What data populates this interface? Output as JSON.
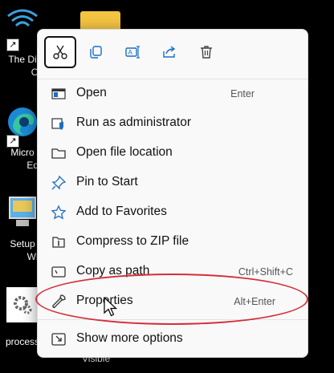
{
  "desktop": {
    "icons": [
      {
        "label_line1": "The Di",
        "label_line2": "Offi"
      },
      {
        "label_line1": "Micro",
        "label_line2": "Edg"
      },
      {
        "label_line1": "Setup",
        "label_line2": "Win"
      },
      {
        "label_line1": "process",
        "label_line2": ""
      }
    ],
    "behind_label": "Visible"
  },
  "toolbar": {
    "buttons": [
      {
        "name": "Cut",
        "icon": "scissors-icon",
        "selected": true
      },
      {
        "name": "Copy",
        "icon": "copy-icon"
      },
      {
        "name": "Rename",
        "icon": "rename-icon"
      },
      {
        "name": "Share",
        "icon": "share-icon"
      },
      {
        "name": "Delete",
        "icon": "trash-icon"
      }
    ]
  },
  "menu": {
    "items": [
      {
        "label": "Open",
        "shortcut": "Enter",
        "icon": "open-app-icon"
      },
      {
        "label": "Run as administrator",
        "shortcut": "",
        "icon": "shield-icon"
      },
      {
        "label": "Open file location",
        "shortcut": "",
        "icon": "folder-icon"
      },
      {
        "label": "Pin to Start",
        "shortcut": "",
        "icon": "pin-icon"
      },
      {
        "label": "Add to Favorites",
        "shortcut": "",
        "icon": "star-icon"
      },
      {
        "label": "Compress to ZIP file",
        "shortcut": "",
        "icon": "zip-icon"
      },
      {
        "label": "Copy as path",
        "shortcut": "Ctrl+Shift+C",
        "icon": "copy-path-icon"
      },
      {
        "label": "Properties",
        "shortcut": "Alt+Enter",
        "icon": "wrench-icon"
      },
      {
        "label": "Show more options",
        "shortcut": "",
        "icon": "more-options-icon"
      }
    ]
  },
  "colors": {
    "menu_bg": "#f9f9f9",
    "annotation": "#d32f3a",
    "accent": "#0067c0"
  }
}
